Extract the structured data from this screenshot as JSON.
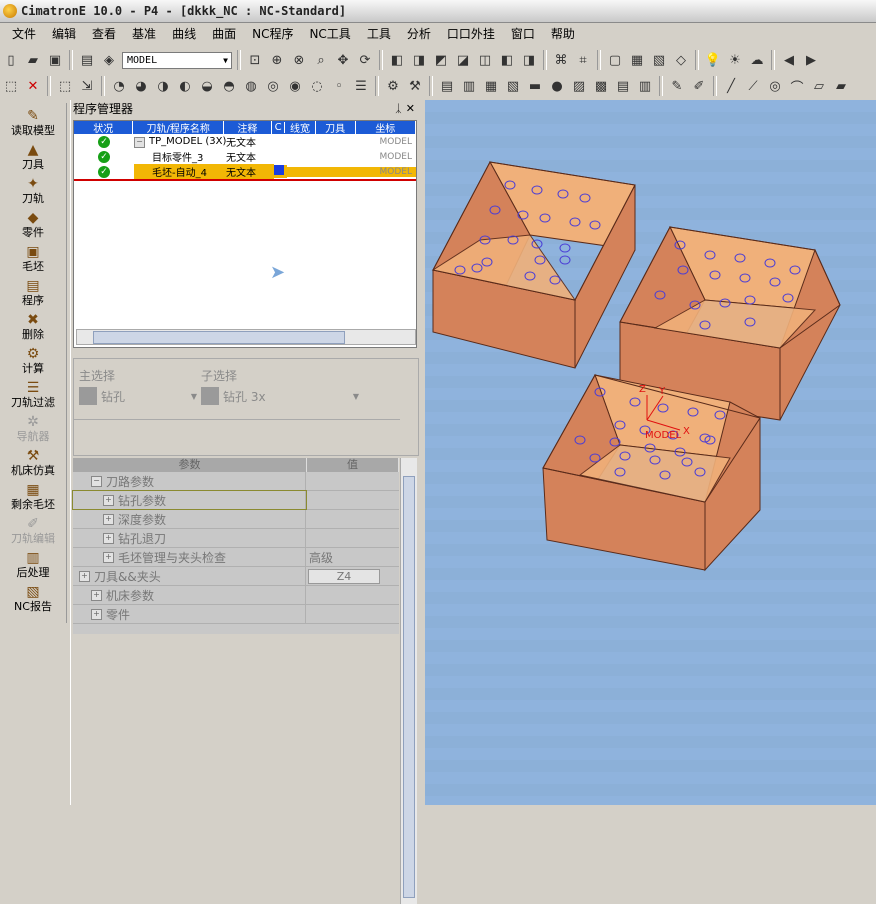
{
  "window": {
    "title": "CimatronE 10.0 - P4 - [dkkk_NC : NC-Standard]"
  },
  "menu": [
    "文件",
    "编辑",
    "查看",
    "基准",
    "曲线",
    "曲面",
    "NC程序",
    "NC工具",
    "工具",
    "分析",
    "口口外挂",
    "窗口",
    "帮助"
  ],
  "toolbar": {
    "model_combo": "MODEL"
  },
  "left_toolbar": [
    {
      "label": "读取模型",
      "icon": "✎",
      "disabled": false
    },
    {
      "label": "刀具",
      "icon": "▲",
      "disabled": false
    },
    {
      "label": "刀轨",
      "icon": "✦",
      "disabled": false
    },
    {
      "label": "零件",
      "icon": "◆",
      "disabled": false
    },
    {
      "label": "毛坯",
      "icon": "▣",
      "disabled": false
    },
    {
      "label": "程序",
      "icon": "▤",
      "disabled": false
    },
    {
      "label": "删除",
      "icon": "✖",
      "disabled": false
    },
    {
      "label": "计算",
      "icon": "⚙",
      "disabled": false
    },
    {
      "label": "刀轨过滤",
      "icon": "☰",
      "disabled": false
    },
    {
      "label": "导航器",
      "icon": "✲",
      "disabled": true
    },
    {
      "label": "机床仿真",
      "icon": "⚒",
      "disabled": false
    },
    {
      "label": "剩余毛坯",
      "icon": "▦",
      "disabled": false
    },
    {
      "label": "刀轨编辑",
      "icon": "✐",
      "disabled": true
    },
    {
      "label": "后处理",
      "icon": "▥",
      "disabled": false
    },
    {
      "label": "NC报告",
      "icon": "▧",
      "disabled": false
    }
  ],
  "program_manager": {
    "title": "程序管理器",
    "columns": [
      "状况",
      "刀轨/程序名称",
      "注释",
      "C",
      "线宽",
      "刀具",
      "坐标"
    ],
    "rows": [
      {
        "name": "TP_MODEL (3X)",
        "note": "无文本",
        "coord": "MODEL",
        "selected": false,
        "expander": "−"
      },
      {
        "name": "目标零件_3",
        "note": "无文本",
        "coord": "MODEL",
        "selected": false,
        "expander": ""
      },
      {
        "name": "毛坯-自动_4",
        "note": "无文本",
        "coord": "MODEL",
        "selected": true,
        "expander": ""
      }
    ]
  },
  "selection": {
    "main_label": "主选择",
    "sub_label": "子选择",
    "main_value": "钻孔",
    "sub_value": "钻孔 3x"
  },
  "params": {
    "header_param": "参数",
    "header_value": "值",
    "rows": [
      {
        "label": "刀路参数",
        "indent": 1,
        "value": ""
      },
      {
        "label": "钻孔参数",
        "indent": 2,
        "value": ""
      },
      {
        "label": "深度参数",
        "indent": 2,
        "value": ""
      },
      {
        "label": "钻孔退刀",
        "indent": 2,
        "value": ""
      },
      {
        "label": "毛坯管理与夹头检查",
        "indent": 2,
        "value": "高级"
      },
      {
        "label": "刀具&&夹头",
        "indent": 0,
        "value": "Z4"
      },
      {
        "label": "机床参数",
        "indent": 1,
        "value": ""
      },
      {
        "label": "零件",
        "indent": 1,
        "value": ""
      }
    ]
  },
  "viewport": {
    "model_label": "MODEL",
    "axis_z": "Z",
    "axis_y": "Y",
    "axis_x": "X"
  },
  "colors": {
    "box_face": "#d4825a",
    "box_floor": "#f0b07a",
    "box_edge": "#5a2b1a",
    "hole": "#4a3dd6",
    "selection": "#f2b705"
  }
}
